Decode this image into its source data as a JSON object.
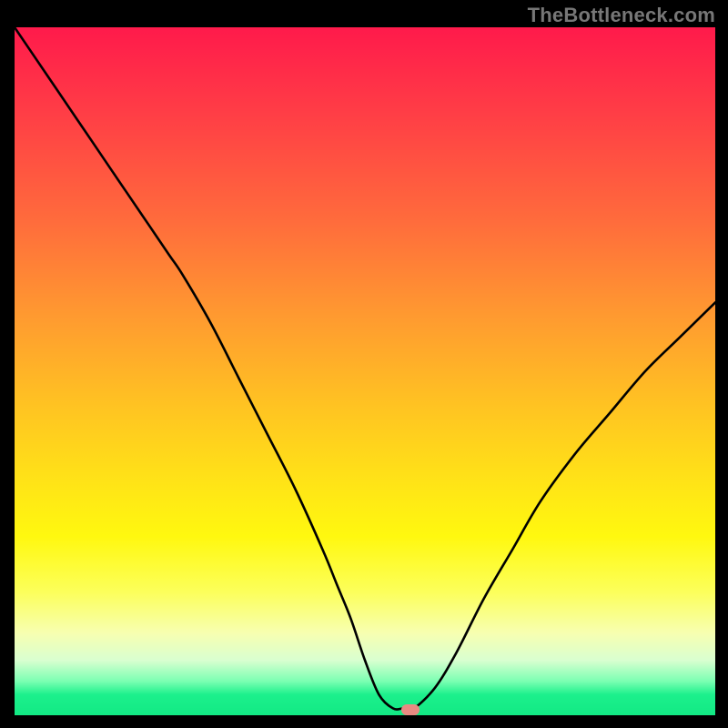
{
  "watermark": "TheBottleneck.com",
  "colors": {
    "background": "#000000",
    "curve": "#000000",
    "dot": "#e88a82",
    "gradient_top": "#ff1a4b",
    "gradient_bottom": "#12e984"
  },
  "chart_data": {
    "type": "line",
    "title": "",
    "xlabel": "",
    "ylabel": "",
    "xlim": [
      0,
      100
    ],
    "ylim": [
      0,
      100
    ],
    "x": [
      0,
      2,
      6,
      10,
      14,
      18,
      22,
      24,
      28,
      32,
      36,
      40,
      44,
      46,
      48,
      50,
      52,
      54,
      55.5,
      57,
      60,
      63,
      67,
      71,
      75,
      80,
      85,
      90,
      95,
      100
    ],
    "values": [
      100,
      97,
      91,
      85,
      79,
      73,
      67,
      64,
      57,
      49,
      41,
      33,
      24,
      19,
      14,
      8,
      3,
      1,
      1,
      1,
      4,
      9,
      17,
      24,
      31,
      38,
      44,
      50,
      55,
      60
    ],
    "marker": {
      "x": 56.5,
      "y": 0.8,
      "shape": "rounded-rect",
      "color": "#e88a82"
    },
    "grid": false,
    "legend": false
  }
}
